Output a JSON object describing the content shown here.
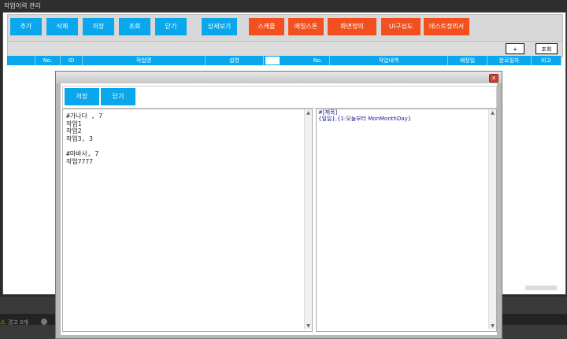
{
  "window": {
    "title": "작업이력 관리"
  },
  "toolbar": {
    "buttons": [
      {
        "label": "추가",
        "color": "#0aa7ec"
      },
      {
        "label": "삭제",
        "color": "#0aa7ec"
      },
      {
        "label": "저장",
        "color": "#0aa7ec"
      },
      {
        "label": "조회",
        "color": "#0aa7ec"
      },
      {
        "label": "닫기",
        "color": "#0aa7ec"
      },
      {
        "label": "상세보기",
        "color": "#0aa7ec"
      },
      {
        "label": "스케쥴",
        "color": "#f2501e"
      },
      {
        "label": "메일스톤",
        "color": "#f2501e"
      },
      {
        "label": "화면정의",
        "color": "#f2501e"
      },
      {
        "label": "UI구성도",
        "color": "#f2501e"
      },
      {
        "label": "테스트정의서",
        "color": "#f2501e"
      }
    ]
  },
  "subbar": {
    "plus_label": "+",
    "search_label": "조회"
  },
  "grid": {
    "columns": [
      "No.",
      "ID",
      "작업명",
      "설명",
      "No.",
      "작업내역",
      "예정일",
      "완료일자",
      "비고"
    ]
  },
  "dialog": {
    "save_label": "저장",
    "close_label": "닫기",
    "close_icon": "x",
    "left_text": "#가나다 , 7\n작업1\n작업2\n작업3, 3\n\n#마바사, 7\n작업7777",
    "right_text": "#[제목]\n{일일},{1:오늘부터 MonMonthDay}"
  },
  "status": {
    "warnings": "경고 0개"
  },
  "colors": {
    "accent": "#0aa7ec",
    "orange": "#f2501e"
  }
}
